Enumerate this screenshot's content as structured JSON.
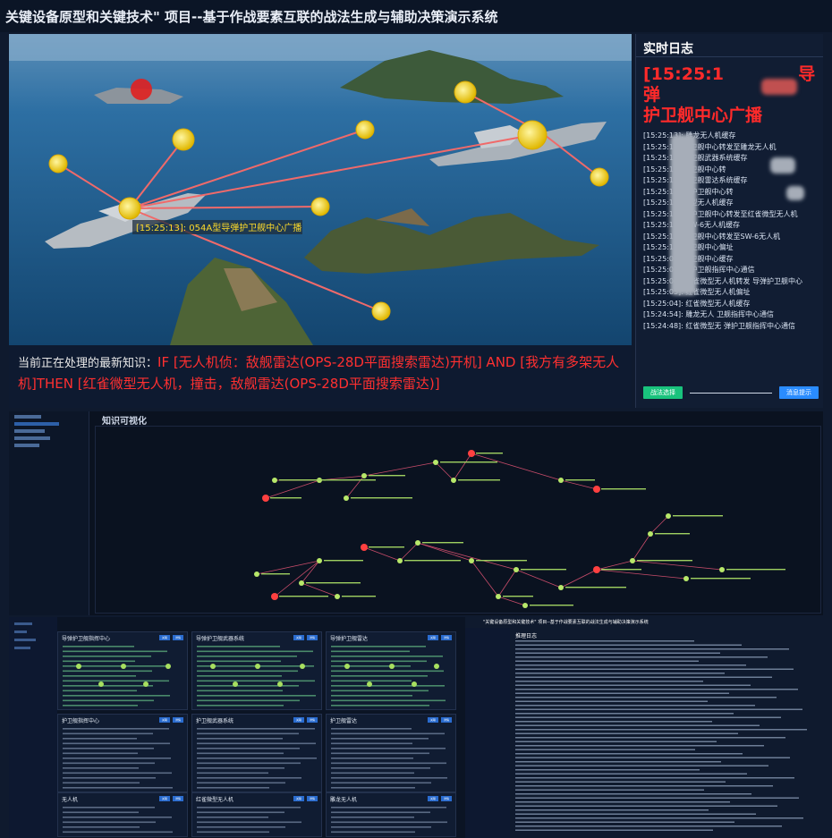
{
  "title": "关键设备原型和关键技术\" 项目--基于作战要素互联的战法生成与辅助决策演示系统",
  "scene": {
    "ship_label": "[15:25:13]: 054A型导弹护卫舰中心广播"
  },
  "knowledge": {
    "label": "当前正在处理的最新知识：",
    "text": "IF [无人机侦：敌舰雷达(OPS-28D平面搜索雷达)开机] AND [我方有多架无人机]THEN [红雀微型无人机，撞击，敌舰雷达(OPS-28D平面搜索雷达)]"
  },
  "log": {
    "title": "实时日志",
    "highlight_line1": "[15:25:1",
    "highlight_line1_tail": "导弹",
    "highlight_line2": "护卫舰中心广播",
    "entries": [
      "[15:25:13]: 雕龙无人机缓存",
      "[15:25:1 弹护卫舰中心转发至雕龙无人机",
      "[15:25:1 弹护卫舰武器系统缓存",
      "[15:25:1 弹护卫舰中心转",
      "[15:25:1 弹护卫舰雷达系统缓存",
      "[15:25:1 导弹护卫舰中心转",
      "[15:25:1 雀微型无人机缓存",
      "[15:25:1 导弹护卫舰中心转发至红雀微型无人机",
      "[15:25:13]: SW-6无人机缓存",
      "[15:25:1 弹护卫舰中心转发至SW-6无人机",
      "[15:25:1 弹护卫舰中心偏址",
      "[15:25:0 弹护卫舰中心缓存",
      "[15:25:0 导弹护卫舰指挥中心通信",
      "[15:25:06]: 红雀微型无人机转发 导弹护卫舰中心",
      "[15:25:05]: 红雀微型无人机偏址",
      "[15:25:04]: 红雀微型无人机缓存",
      "[15:24:54]: 雕龙无人 卫舰指挥中心通信",
      "[15:24:48]: 红雀微型无 弹护卫舰指挥中心通信"
    ],
    "btn_left": "战法选择",
    "btn_right": "消息提示"
  },
  "kv": {
    "title": "知识可视化"
  },
  "dash": {
    "cards": [
      {
        "title": "导弹护卫舰指挥中心",
        "btn1": "关联",
        "btn2": "详情"
      },
      {
        "title": "导弹护卫舰武器系统",
        "btn1": "关联",
        "btn2": "详情"
      },
      {
        "title": "导弹护卫舰雷达",
        "btn1": "关联",
        "btn2": "详情"
      },
      {
        "title": "护卫舰指挥中心",
        "btn1": "关联",
        "btn2": "详情"
      },
      {
        "title": "护卫舰武器系统",
        "btn1": "关联",
        "btn2": "详情"
      },
      {
        "title": "护卫舰雷达",
        "btn1": "关联",
        "btn2": "详情"
      },
      {
        "title": "无人机",
        "btn1": "关联",
        "btn2": "详情"
      },
      {
        "title": "红雀微型无人机",
        "btn1": "关联",
        "btn2": "详情"
      },
      {
        "title": "雕龙无人机",
        "btn1": "关联",
        "btn2": "详情"
      }
    ],
    "right_title": "\"关键设备原型和关键技术\" 项目--基于作战要素互联的战法生成与辅助决策演示系统",
    "right_head": "推理日志"
  }
}
